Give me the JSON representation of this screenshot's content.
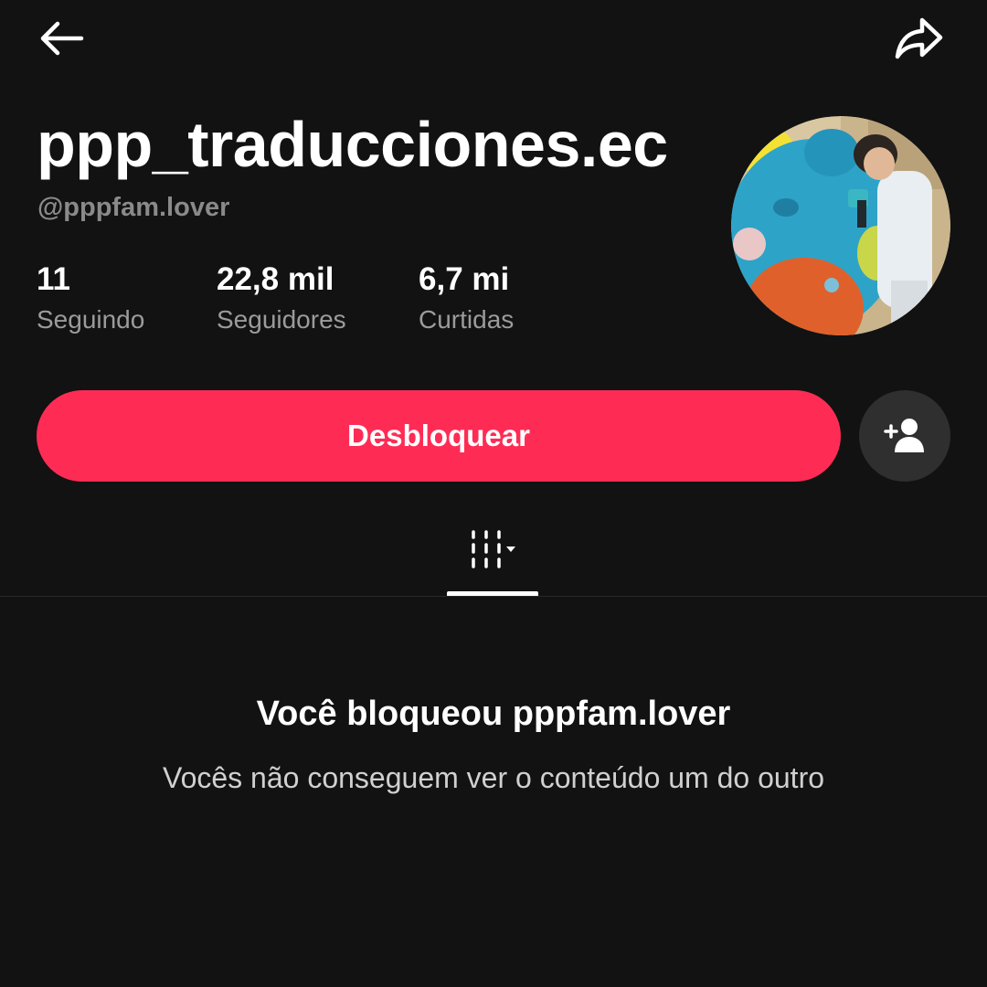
{
  "header": {
    "back_icon": "arrow-left-icon",
    "share_icon": "share-arrow-icon"
  },
  "profile": {
    "display_name": "ppp_traducciones.ec",
    "username": "@pppfam.lover",
    "avatar_icon": "profile-photo"
  },
  "stats": [
    {
      "value": "11",
      "label": "Seguindo"
    },
    {
      "value": "22,8 mil",
      "label": "Seguidores"
    },
    {
      "value": "6,7 mi",
      "label": "Curtidas"
    }
  ],
  "actions": {
    "unblock_label": "Desbloquear",
    "add_friend_icon": "add-person-icon"
  },
  "tabs": {
    "videos_icon": "grid-icon",
    "dropdown_icon": "caret-down-icon"
  },
  "empty_state": {
    "title": "Você bloqueou pppfam.lover",
    "message": "Vocês não conseguem ver o conteúdo um do outro"
  },
  "colors": {
    "background": "#121212",
    "accent": "#fe2c55",
    "secondary_text": "#8a8a8a",
    "circle_button": "#2f2f2f"
  }
}
